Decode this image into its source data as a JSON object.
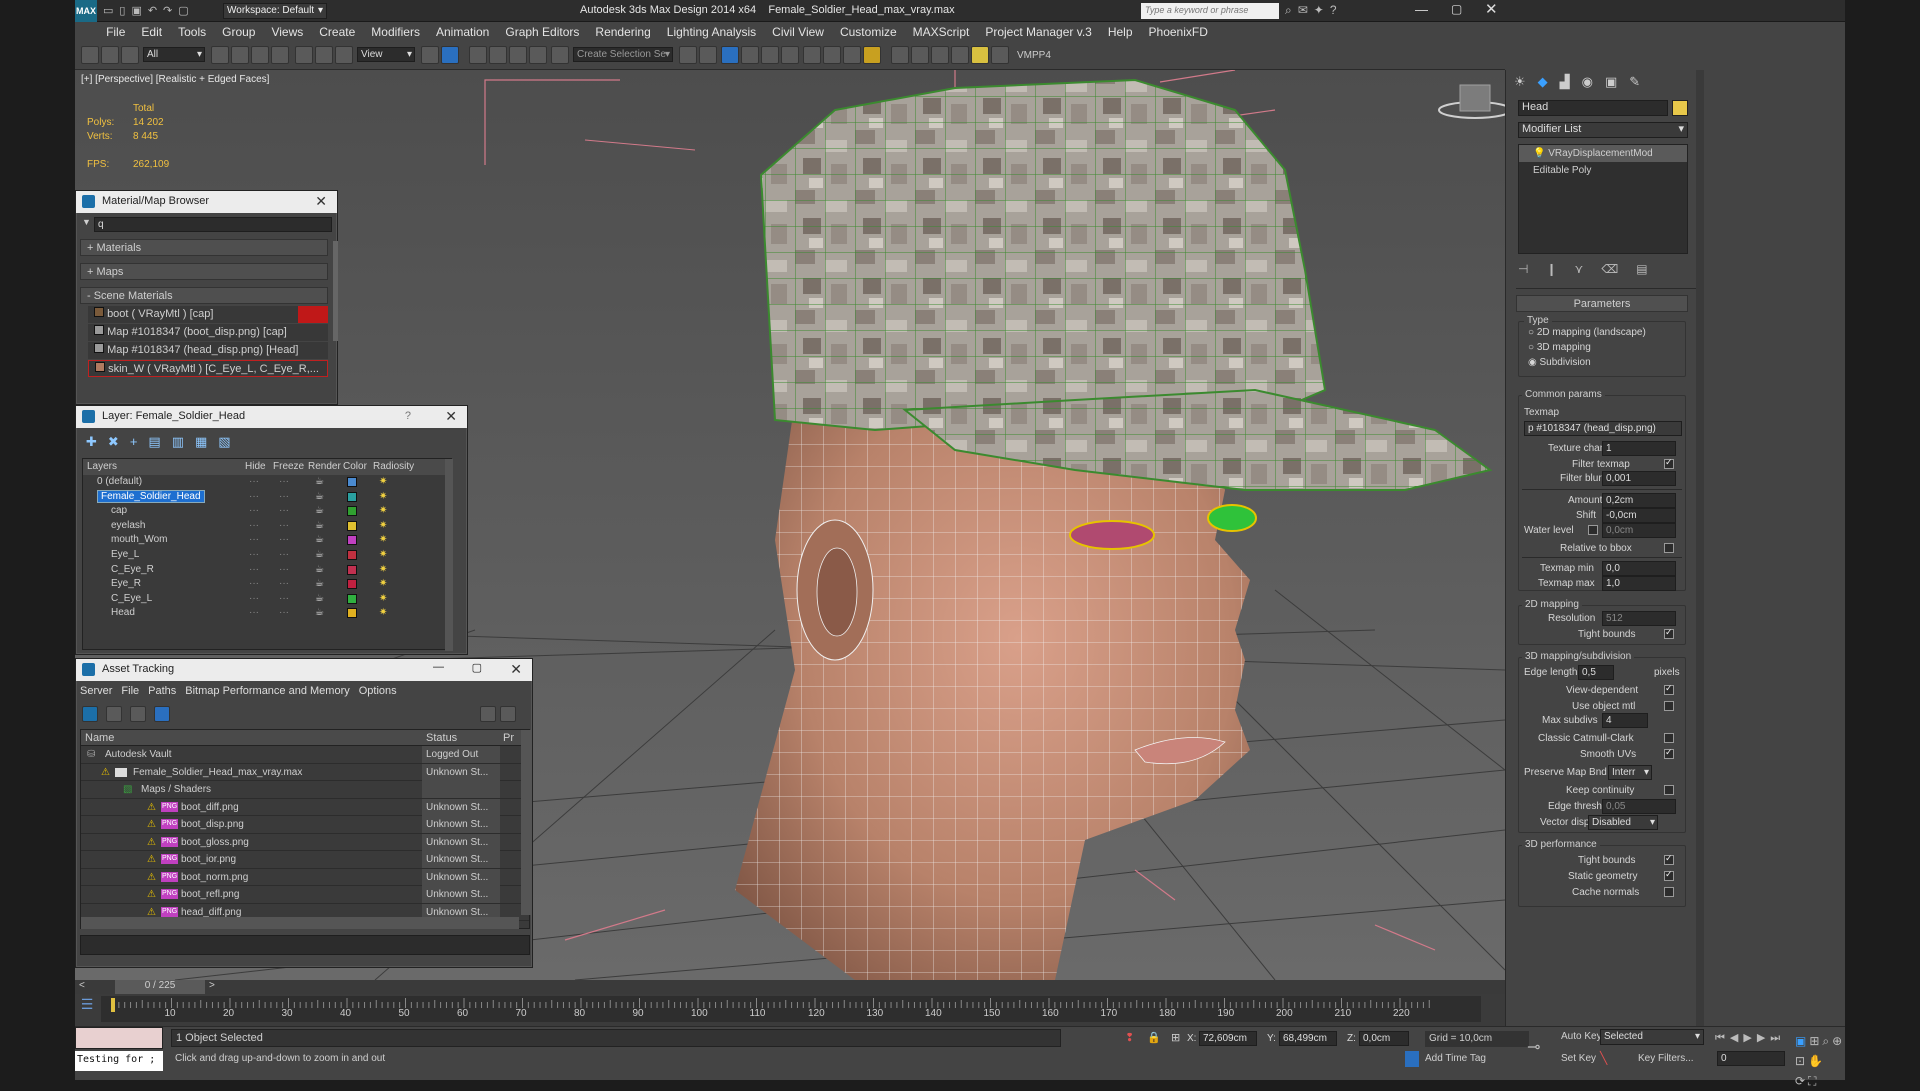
{
  "title": {
    "workspace": "Workspace: Default",
    "app_name": "Autodesk 3ds Max Design 2014 x64",
    "file_name": "Female_Soldier_Head_max_vray.max",
    "search_placeholder": "Type a keyword or phrase"
  },
  "menu": [
    "File",
    "Edit",
    "Tools",
    "Group",
    "Views",
    "Create",
    "Modifiers",
    "Animation",
    "Graph Editors",
    "Rendering",
    "Lighting Analysis",
    "Civil View",
    "Customize",
    "MAXScript",
    "Project Manager v.3",
    "Help",
    "PhoenixFD"
  ],
  "toolbar": {
    "selection_filter": "All",
    "ref_coord": "View",
    "named_selection": "Create Selection Se",
    "vmpp": "VMPP4"
  },
  "viewport": {
    "label": "[+] [Perspective] [Realistic + Edged Faces]",
    "stats_total": "Total",
    "polys_label": "Polys:",
    "polys_value": "14 202",
    "verts_label": "Verts:",
    "verts_value": "8 445",
    "fps_label": "FPS:",
    "fps_value": "262,109"
  },
  "material_browser": {
    "title": "Material/Map Browser",
    "search_value": "q",
    "sections": [
      "+ Materials",
      "+ Maps",
      "- Scene Materials"
    ],
    "items": [
      {
        "label": "boot  ( VRayMtl )  [cap]",
        "swatch": "#7a5a3a"
      },
      {
        "label": "Map #1018347 (boot_disp.png)  [cap]",
        "swatch": "#9a9a9a"
      },
      {
        "label": "Map #1018347 (head_disp.png)  [Head]",
        "swatch": "#9a9a9a"
      },
      {
        "label": "skin_W  ( VRayMtl )  [C_Eye_L, C_Eye_R,...",
        "swatch": "#b07a60"
      }
    ]
  },
  "layer_manager": {
    "title": "Layer: Female_Soldier_Head",
    "help": "?",
    "columns": [
      "Layers",
      "Hide",
      "Freeze",
      "Render",
      "Color",
      "Radiosity"
    ],
    "rows": [
      {
        "name": "0 (default)",
        "color": "#4a8ad0",
        "selected": false
      },
      {
        "name": "Female_Soldier_Head",
        "color": "#2aa0a0",
        "selected": true
      },
      {
        "name": "cap",
        "color": "#30a030",
        "selected": false
      },
      {
        "name": "eyelash",
        "color": "#e0c030",
        "selected": false
      },
      {
        "name": "mouth_Wom",
        "color": "#c040c0",
        "selected": false
      },
      {
        "name": "Eye_L",
        "color": "#c03040",
        "selected": false
      },
      {
        "name": "C_Eye_R",
        "color": "#c03050",
        "selected": false
      },
      {
        "name": "Eye_R",
        "color": "#c02040",
        "selected": false
      },
      {
        "name": "C_Eye_L",
        "color": "#30b040",
        "selected": false
      },
      {
        "name": "Head",
        "color": "#e0b020",
        "selected": false
      }
    ]
  },
  "asset_tracking": {
    "title": "Asset Tracking",
    "menu": [
      "Server",
      "File",
      "Paths",
      "Bitmap Performance and Memory",
      "Options"
    ],
    "columns": [
      "Name",
      "Status",
      "Pr"
    ],
    "rows": [
      {
        "name": "Autodesk Vault",
        "status": "Logged Out"
      },
      {
        "name": "Female_Soldier_Head_max_vray.max",
        "status": "Unknown St..."
      },
      {
        "name": "Maps / Shaders",
        "status": ""
      },
      {
        "name": "boot_diff.png",
        "status": "Unknown St..."
      },
      {
        "name": "boot_disp.png",
        "status": "Unknown St..."
      },
      {
        "name": "boot_gloss.png",
        "status": "Unknown St..."
      },
      {
        "name": "boot_ior.png",
        "status": "Unknown St..."
      },
      {
        "name": "boot_norm.png",
        "status": "Unknown St..."
      },
      {
        "name": "boot_refl.png",
        "status": "Unknown St..."
      },
      {
        "name": "head_diff.png",
        "status": "Unknown St..."
      }
    ],
    "png_badge": "PNG"
  },
  "command_panel": {
    "object_name": "Head",
    "modifier_list": "Modifier List",
    "stack": [
      "VRayDisplacementMod",
      "Editable Poly"
    ],
    "parameters": "Parameters",
    "type_label": "Type",
    "type_options": [
      "2D mapping (landscape)",
      "3D mapping",
      "Subdivision"
    ],
    "common_params": "Common params",
    "texmap_label": "Texmap",
    "texmap_value": "p #1018347 (head_disp.png)",
    "texture_chan_label": "Texture chan",
    "texture_chan_value": "1",
    "filter_texmap": "Filter texmap",
    "filter_blur_label": "Filter blur",
    "filter_blur_value": "0,001",
    "amount_label": "Amount",
    "amount_value": "0,2cm",
    "shift_label": "Shift",
    "shift_value": "-0,0cm",
    "water_level_label": "Water level",
    "water_level_value": "0,0cm",
    "relative_bbox": "Relative to bbox",
    "texmap_min_label": "Texmap min",
    "texmap_min_value": "0,0",
    "texmap_max_label": "Texmap max",
    "texmap_max_value": "1,0",
    "mapping2d": "2D mapping",
    "resolution_label": "Resolution",
    "resolution_value": "512",
    "tight_bounds": "Tight bounds",
    "mapping3d": "3D mapping/subdivision",
    "edge_length_label": "Edge length",
    "edge_length_value": "0,5",
    "pixels": "pixels",
    "view_dependent": "View-dependent",
    "use_object_mtl": "Use object mtl",
    "max_subdivs_label": "Max subdivs",
    "max_subdivs_value": "4",
    "classic_catmull": "Classic Catmull-Clark",
    "smooth_uvs": "Smooth UVs",
    "preserve_map_label": "Preserve Map Bnd",
    "preserve_map_value": "Interr",
    "keep_continuity": "Keep continuity",
    "edge_thresh_label": "Edge thresh",
    "edge_thresh_value": "0,05",
    "vector_displ_label": "Vector displ",
    "vector_displ_value": "Disabled",
    "perf3d": "3D performance",
    "tight_bounds2": "Tight bounds",
    "static_geometry": "Static geometry",
    "cache_normals": "Cache normals"
  },
  "timeline": {
    "frame": "0 / 225",
    "ticks": [
      "10",
      "20",
      "30",
      "40",
      "50",
      "60",
      "70",
      "80",
      "90",
      "100",
      "110",
      "120",
      "130",
      "140",
      "150",
      "160",
      "170",
      "180",
      "190",
      "200",
      "210",
      "220"
    ]
  },
  "status": {
    "maxscript": "Testing for ;",
    "selected": "1 Object Selected",
    "prompt": "Click and drag up-and-down to zoom in and out",
    "x_label": "X:",
    "x_value": "72,609cm",
    "y_label": "Y:",
    "y_value": "68,499cm",
    "z_label": "Z:",
    "z_value": "0,0cm",
    "grid": "Grid = 10,0cm",
    "add_time_tag": "Add Time Tag",
    "auto_key": "Auto Key",
    "selected_dd": "Selected",
    "set_key": "Set Key",
    "key_filters": "Key Filters...",
    "frame_field": "0"
  }
}
